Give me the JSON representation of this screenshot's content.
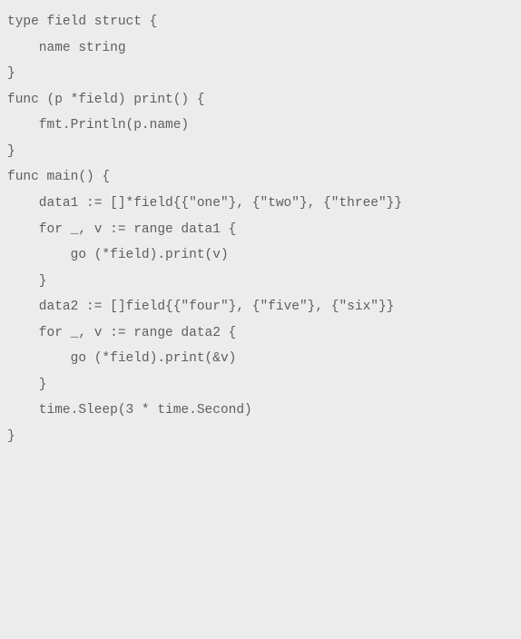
{
  "code": {
    "lines": [
      "type field struct {",
      "    name string",
      "}",
      "",
      "func (p *field) print() {",
      "    fmt.Println(p.name)",
      "}",
      "",
      "func main() {",
      "    data1 := []*field{{\"one\"}, {\"two\"}, {\"three\"}}",
      "    for _, v := range data1 {",
      "        go (*field).print(v)",
      "    }",
      "",
      "    data2 := []field{{\"four\"}, {\"five\"}, {\"six\"}}",
      "    for _, v := range data2 {",
      "        go (*field).print(&v)",
      "    }",
      "",
      "    time.Sleep(3 * time.Second)",
      "}"
    ]
  }
}
